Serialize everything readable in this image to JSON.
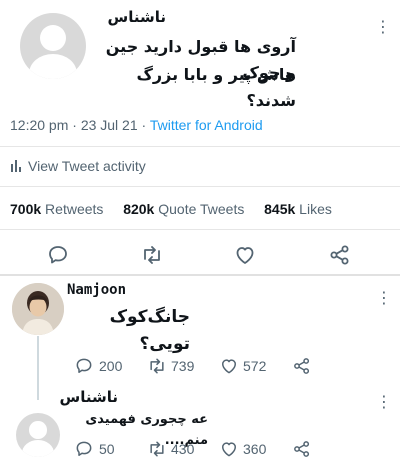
{
  "main_tweet": {
    "username": "ناشناس",
    "text_line1": "آروی ها قبول دارید جین و جوک",
    "text_line2": "هاش پیر و بابا بزرگ شدند؟",
    "timestamp": "12:20 pm · 23 Jul 21 · ",
    "source": "Twitter for Android",
    "activity_label": "View Tweet activity",
    "retweets_count": "700k",
    "retweets_label": " Retweets",
    "quotes_count": "820k",
    "quotes_label": " Quote Tweets",
    "likes_count": "845k",
    "likes_label": " Likes"
  },
  "reply_1": {
    "username": "Namjoon",
    "text": "جانگ‌کوک تویی؟",
    "replies": "200",
    "retweets": "739",
    "likes": "572"
  },
  "reply_2": {
    "username": "ناشناس",
    "text": "عه چجوری فهمیدی منم....",
    "replies": "50",
    "retweets": "430",
    "likes": "360"
  },
  "colors": {
    "accent": "#1d9bf0",
    "muted": "#536471",
    "divider": "#e6e6e6"
  },
  "icons": [
    "more-icon",
    "bar-chart-icon",
    "reply-icon",
    "retweet-icon",
    "like-icon",
    "share-icon"
  ]
}
